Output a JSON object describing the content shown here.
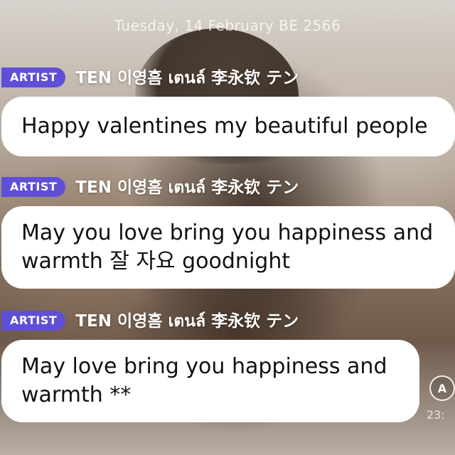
{
  "date_header": "Tuesday, 14 February BE 2566",
  "messages": [
    {
      "badge": "ARTIST",
      "sender": "TEN 이영흠 เตนล์ 李永钦 テン",
      "text": "Happy valentines my beautiful people"
    },
    {
      "badge": "ARTIST",
      "sender": "TEN 이영흠 เตนล์ 李永钦 テン",
      "text": "May you love bring you happiness and warmth 잘 자요 goodnight"
    },
    {
      "badge": "ARTIST",
      "sender": "TEN 이영흠 เตนล์ 李永钦 テン",
      "text": "May love bring you happiness and warmth **"
    }
  ],
  "translate_icon_glyph": "A",
  "timestamp_partial": "23:"
}
